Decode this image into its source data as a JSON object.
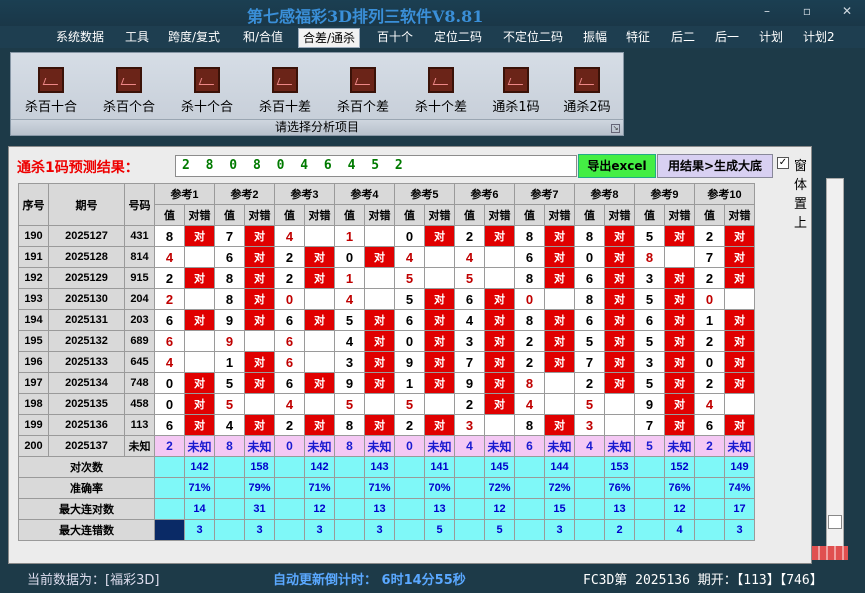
{
  "app": {
    "title": "第七感福彩3D排列三软件V8.81"
  },
  "menu": [
    "系统数据",
    "工具",
    "跨度/复式",
    "和/合值",
    "合差/通杀",
    "百十个",
    "定位二码",
    "不定位二码",
    "振幅",
    "特征",
    "后二",
    "后一",
    "计划",
    "计划2"
  ],
  "menu_active": "合差/通杀",
  "ribbon": {
    "buttons": [
      "杀百十合",
      "杀百个合",
      "杀十个合",
      "杀百十差",
      "杀百个差",
      "杀十个差",
      "通杀1码",
      "通杀2码"
    ],
    "caption": "请选择分析项目"
  },
  "prediction": {
    "label": "通杀1码预测结果：",
    "value": "2 8 0 8 0 4 6 4 5 2"
  },
  "buttons": {
    "export": "导出excel",
    "generate": "用结果>生成大底"
  },
  "checkbox": {
    "label": "窗体置上",
    "checked": true,
    "mark": "✓"
  },
  "table": {
    "headers": {
      "seq": "序号",
      "period": "期号",
      "number": "号码",
      "val": "值",
      "judge": "对错",
      "right_mark": "对"
    },
    "refs": [
      "参考1",
      "参考2",
      "参考3",
      "参考4",
      "参考5",
      "参考6",
      "参考7",
      "参考8",
      "参考9",
      "参考10"
    ],
    "rows": [
      {
        "seq": "190",
        "period": "2025127",
        "number": "431",
        "vals": [
          "8",
          "7",
          "4",
          "1",
          "0",
          "2",
          "8",
          "8",
          "5",
          "2"
        ],
        "rights": [
          1,
          1,
          0,
          0,
          1,
          1,
          1,
          1,
          1,
          1
        ]
      },
      {
        "seq": "191",
        "period": "2025128",
        "number": "814",
        "vals": [
          "4",
          "6",
          "2",
          "0",
          "4",
          "4",
          "6",
          "0",
          "8",
          "7"
        ],
        "rights": [
          0,
          1,
          1,
          1,
          0,
          0,
          1,
          1,
          0,
          1
        ]
      },
      {
        "seq": "192",
        "period": "2025129",
        "number": "915",
        "vals": [
          "2",
          "8",
          "2",
          "1",
          "5",
          "5",
          "8",
          "6",
          "3",
          "2"
        ],
        "rights": [
          1,
          1,
          1,
          0,
          0,
          0,
          1,
          1,
          1,
          1
        ]
      },
      {
        "seq": "193",
        "period": "2025130",
        "number": "204",
        "vals": [
          "2",
          "8",
          "0",
          "4",
          "5",
          "6",
          "0",
          "8",
          "5",
          "0"
        ],
        "rights": [
          0,
          1,
          0,
          0,
          1,
          1,
          0,
          1,
          1,
          0
        ]
      },
      {
        "seq": "194",
        "period": "2025131",
        "number": "203",
        "vals": [
          "6",
          "9",
          "6",
          "5",
          "6",
          "4",
          "8",
          "6",
          "6",
          "1"
        ],
        "rights": [
          1,
          1,
          1,
          1,
          1,
          1,
          1,
          1,
          1,
          1
        ]
      },
      {
        "seq": "195",
        "period": "2025132",
        "number": "689",
        "vals": [
          "6",
          "9",
          "6",
          "4",
          "0",
          "3",
          "2",
          "5",
          "5",
          "2"
        ],
        "rights": [
          0,
          0,
          0,
          1,
          1,
          1,
          1,
          1,
          1,
          1
        ]
      },
      {
        "seq": "196",
        "period": "2025133",
        "number": "645",
        "vals": [
          "4",
          "1",
          "6",
          "3",
          "9",
          "7",
          "2",
          "7",
          "3",
          "0"
        ],
        "rights": [
          0,
          1,
          0,
          1,
          1,
          1,
          1,
          1,
          1,
          1
        ]
      },
      {
        "seq": "197",
        "period": "2025134",
        "number": "748",
        "vals": [
          "0",
          "5",
          "6",
          "9",
          "1",
          "9",
          "8",
          "2",
          "5",
          "2"
        ],
        "rights": [
          1,
          1,
          1,
          1,
          1,
          1,
          0,
          1,
          1,
          1
        ]
      },
      {
        "seq": "198",
        "period": "2025135",
        "number": "458",
        "vals": [
          "0",
          "5",
          "4",
          "5",
          "5",
          "2",
          "4",
          "5",
          "9",
          "4"
        ],
        "rights": [
          1,
          0,
          0,
          0,
          0,
          1,
          0,
          0,
          1,
          0
        ]
      },
      {
        "seq": "199",
        "period": "2025136",
        "number": "113",
        "vals": [
          "6",
          "4",
          "2",
          "8",
          "2",
          "3",
          "8",
          "3",
          "7",
          "6"
        ],
        "rights": [
          1,
          1,
          1,
          1,
          1,
          0,
          1,
          0,
          1,
          1
        ]
      }
    ],
    "current": {
      "seq": "200",
      "period": "2025137",
      "number": "未知",
      "vals": [
        "2",
        "8",
        "0",
        "8",
        "0",
        "4",
        "6",
        "4",
        "5",
        "2"
      ],
      "unknown": "未知"
    },
    "stats": [
      {
        "label": "对次数",
        "vals": [
          "142",
          "158",
          "142",
          "143",
          "141",
          "145",
          "144",
          "153",
          "152",
          "149"
        ]
      },
      {
        "label": "准确率",
        "vals": [
          "71%",
          "79%",
          "71%",
          "71%",
          "70%",
          "72%",
          "72%",
          "76%",
          "76%",
          "74%"
        ]
      },
      {
        "label": "最大连对数",
        "vals": [
          "14",
          "31",
          "12",
          "13",
          "13",
          "12",
          "15",
          "13",
          "12",
          "17"
        ]
      },
      {
        "label": "最大连错数",
        "vals": [
          "3",
          "3",
          "3",
          "3",
          "5",
          "5",
          "3",
          "2",
          "4",
          "3"
        ]
      }
    ]
  },
  "status": {
    "current": "当前数据为：[福彩3D]",
    "countdown": "自动更新倒计时： 6时14分55秒",
    "issue": "FC3D第 2025136 期开：【113】【746】"
  },
  "colors": {
    "red": "#e00000",
    "cyan": "#7ff8f8",
    "pink": "#f4c8f4",
    "green_btn": "#44ee44",
    "title_blue": "#3a8fd8"
  },
  "icons": [
    "chart-icon",
    "minimize-icon",
    "restore-icon",
    "close-icon",
    "checkmark-icon"
  ]
}
